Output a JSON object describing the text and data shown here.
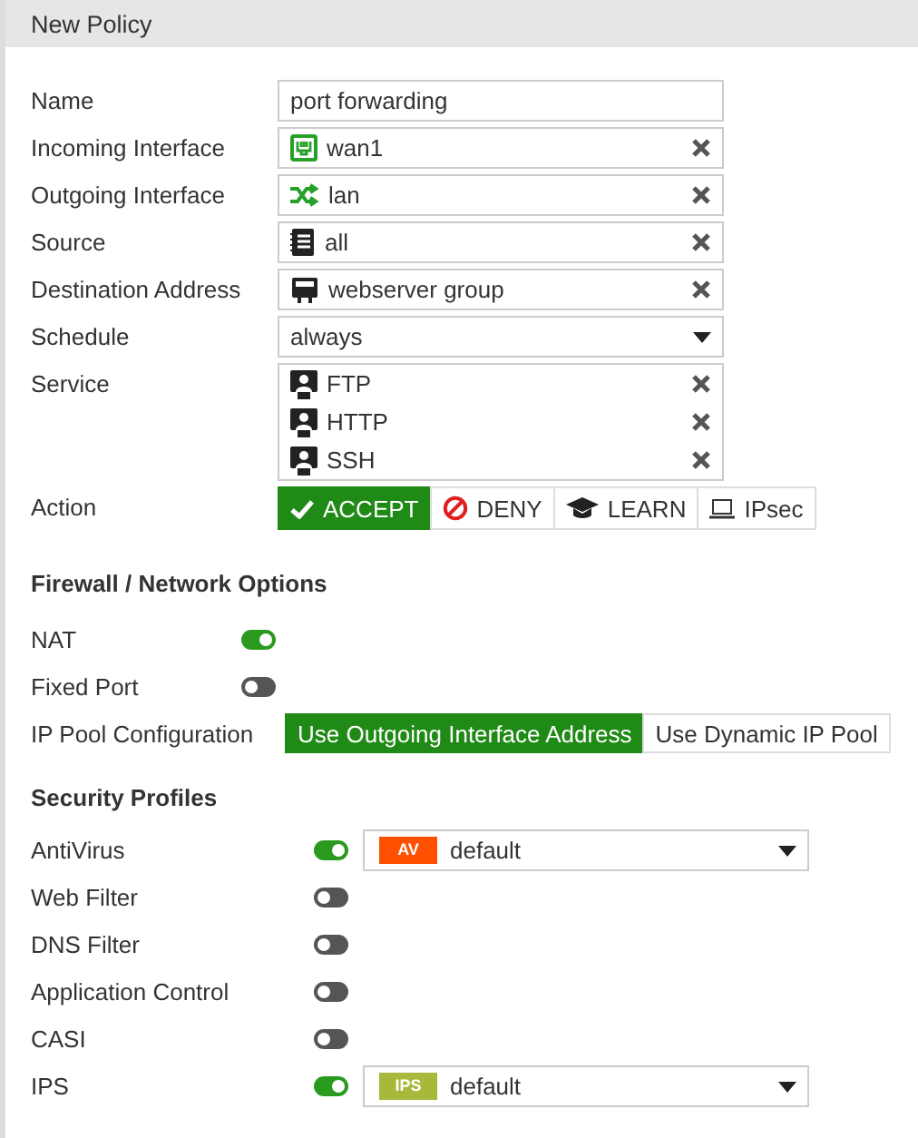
{
  "window": {
    "title": "New Policy"
  },
  "fields": [
    {
      "label": "Name",
      "kind": "text",
      "value": "port forwarding"
    },
    {
      "label": "Incoming Interface",
      "kind": "chips",
      "items": [
        {
          "kind": "port",
          "text": "wan1"
        }
      ]
    },
    {
      "label": "Outgoing Interface",
      "kind": "chips",
      "items": [
        {
          "kind": "shuffle",
          "text": "lan"
        }
      ]
    },
    {
      "label": "Source",
      "kind": "chips",
      "items": [
        {
          "kind": "list",
          "text": "all"
        }
      ]
    },
    {
      "label": "Destination Address",
      "kind": "chips",
      "items": [
        {
          "kind": "group",
          "text": "webserver group"
        }
      ]
    },
    {
      "label": "Schedule",
      "kind": "select",
      "value": "always"
    },
    {
      "label": "Service",
      "kind": "chips",
      "items": [
        {
          "kind": "service",
          "text": "FTP"
        },
        {
          "kind": "service",
          "text": "HTTP"
        },
        {
          "kind": "service",
          "text": "SSH"
        }
      ]
    },
    {
      "label": "Action",
      "kind": "segments",
      "options": [
        {
          "kind": "accept",
          "text": "ACCEPT",
          "selected": true
        },
        {
          "kind": "deny",
          "text": "DENY",
          "selected": false
        },
        {
          "kind": "learn",
          "text": "LEARN",
          "selected": false
        },
        {
          "kind": "ipsec",
          "text": "IPsec",
          "selected": false
        }
      ]
    }
  ],
  "firewall": {
    "title": "Firewall / Network Options",
    "toggles": [
      {
        "label": "NAT",
        "on": true
      },
      {
        "label": "Fixed Port",
        "on": false
      }
    ],
    "ip_pool": {
      "label": "IP Pool Configuration",
      "options": [
        {
          "text": "Use Outgoing Interface Address",
          "selected": true
        },
        {
          "text": "Use Dynamic IP Pool",
          "selected": false
        }
      ]
    }
  },
  "security": {
    "title": "Security Profiles",
    "profiles": [
      {
        "label": "AntiVirus",
        "on": true,
        "badge": "AV",
        "color": "#ff4f00",
        "value": "default"
      },
      {
        "label": "Web Filter",
        "on": false
      },
      {
        "label": "DNS Filter",
        "on": false
      },
      {
        "label": "Application Control",
        "on": false
      },
      {
        "label": "CASI",
        "on": false
      },
      {
        "label": "IPS",
        "on": true,
        "badge": "IPS",
        "color": "#a8b83a",
        "value": "default"
      }
    ]
  }
}
